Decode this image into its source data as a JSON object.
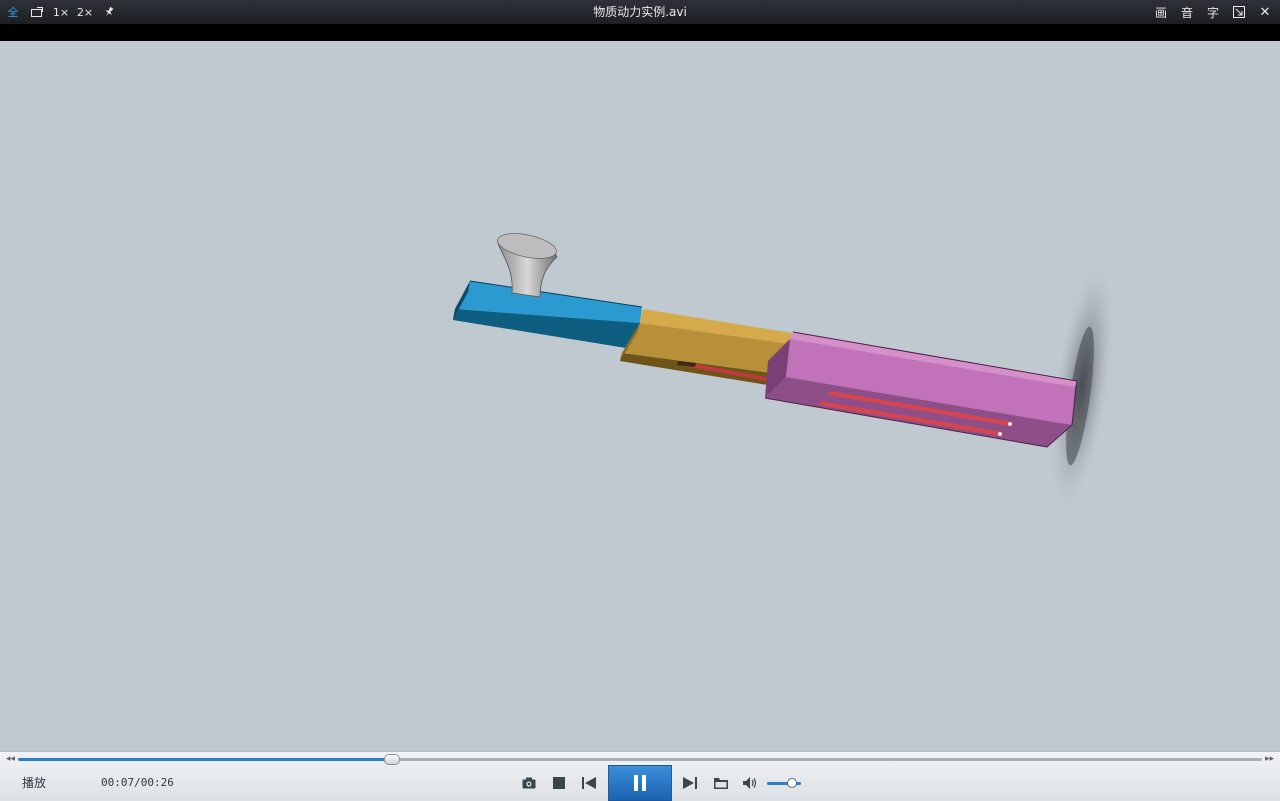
{
  "window": {
    "title": "物质动力实例.avi"
  },
  "titlebar_left": [
    {
      "name": "fullscreen-button",
      "label": "全",
      "icon": "fullscreen-icon"
    },
    {
      "name": "mini-mode-button",
      "label": "",
      "icon": "mini-window-icon"
    },
    {
      "name": "size-1x-button",
      "label": "1×",
      "icon": ""
    },
    {
      "name": "size-2x-button",
      "label": "2×",
      "icon": ""
    },
    {
      "name": "pin-top-button",
      "label": "",
      "icon": "pin-icon"
    }
  ],
  "titlebar_right": [
    {
      "name": "picture-settings-button",
      "label": "画"
    },
    {
      "name": "audio-settings-button",
      "label": "音"
    },
    {
      "name": "subtitle-settings-button",
      "label": "字"
    },
    {
      "name": "screen-ratio-button",
      "label": "",
      "icon": "aspect-icon"
    },
    {
      "name": "close-button",
      "label": "✕",
      "icon": "close-icon"
    }
  ],
  "playback": {
    "status_label": "播放",
    "time_display": "00:07/00:26",
    "progress": 0.3
  },
  "volume": {
    "level": 0.7
  },
  "colors": {
    "accent": "#2a7fc9",
    "video_background": "#c0c8d0",
    "part_blue": "#1a86b8",
    "part_gold": "#b48d36",
    "part_pink": "#c272b9"
  }
}
